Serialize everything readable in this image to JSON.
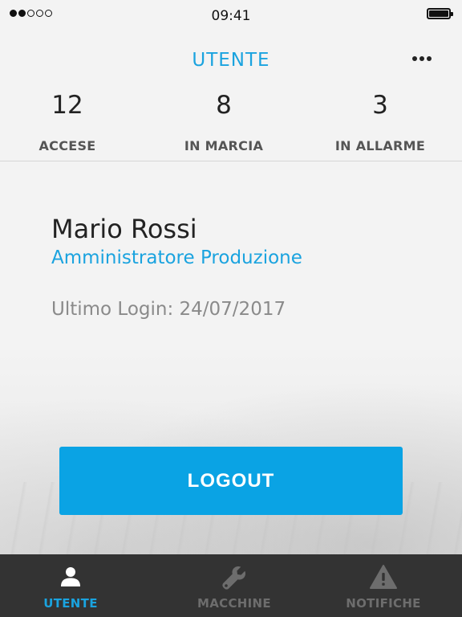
{
  "status_bar": {
    "time": "09:41",
    "signal_filled": 2,
    "signal_total": 5
  },
  "header": {
    "title": "UTENTE",
    "more_icon": "more-horizontal-icon"
  },
  "stats": [
    {
      "value": "12",
      "label": "ACCESE"
    },
    {
      "value": "8",
      "label": "IN MARCIA"
    },
    {
      "value": "3",
      "label": "IN ALLARME"
    }
  ],
  "user": {
    "name": "Mario Rossi",
    "role": "Amministratore Produzione",
    "last_login": "Ultimo Login: 24/07/2017"
  },
  "logout_label": "LOGOUT",
  "tabs": [
    {
      "label": "UTENTE",
      "icon": "user-icon",
      "active": true
    },
    {
      "label": "MACCHINE",
      "icon": "wrench-icon",
      "active": false
    },
    {
      "label": "NOTIFICHE",
      "icon": "warning-icon",
      "active": false
    }
  ],
  "colors": {
    "accent": "#1aa3df",
    "button": "#0aa3e4",
    "tab_bar": "#333333",
    "inactive_tab": "#6d6d6d"
  }
}
